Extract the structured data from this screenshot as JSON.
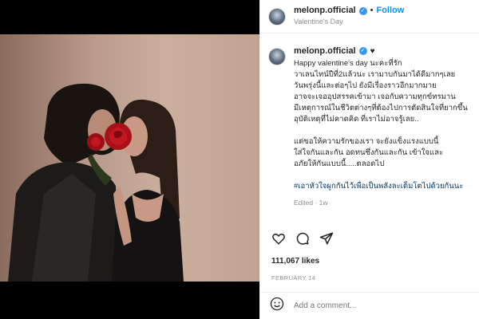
{
  "post": {
    "username": "melonp.official",
    "follow_label": "Follow",
    "separator": "•",
    "location": "Valentine's Day",
    "caption_heart": "♥",
    "caption_lines": [
      "Happy valentine's day นะคะที่รัก",
      "วาเลนไทน์ปีที่2แล้วนะ เรามาบกันมาได้ดีมากๆเลย",
      "วันพรุ่งนี้และต่อๆไป ยังมีเรื่องราวอีกมากมาย",
      "อาจจะเจออุปสรรคเข้ามา เจอกับความทุกข์ทรมาน",
      "มีเหตุการณ์ในชีวิตต่างๆที่ต้องไปการตัดสินใจที่ยากขึ้น",
      "อุบัติเหตุที่ไม่คาดคิด ที่เราไม่อาจรู้เลย..",
      "",
      "แต่ขอให้ความรักของเรา จะยังแข็งแรงแบบนี้",
      "ใส่ใจกันและกัน อดทนซึ่งกันและกัน เข้าใจและ",
      "อภัยให้กันแบบนี้.....ตลอดไป"
    ],
    "hashtag": "#เอาหัวใจผูกกันไว้เพื่อเป็นพลังละเต็มโตไปด้วยกันนะ",
    "edited": "Edited · 1w",
    "likes": "111,067 likes",
    "date": "FEBRUARY 14",
    "comment_placeholder": "Add a comment..."
  },
  "colors": {
    "verified_blue": "#3897f0",
    "follow_blue": "#0095f6",
    "hashtag_blue": "#00376b",
    "muted_gray": "#8e8e8e"
  },
  "icons": [
    "heart-icon",
    "comment-icon",
    "share-icon",
    "emoji-icon",
    "verified-icon"
  ]
}
